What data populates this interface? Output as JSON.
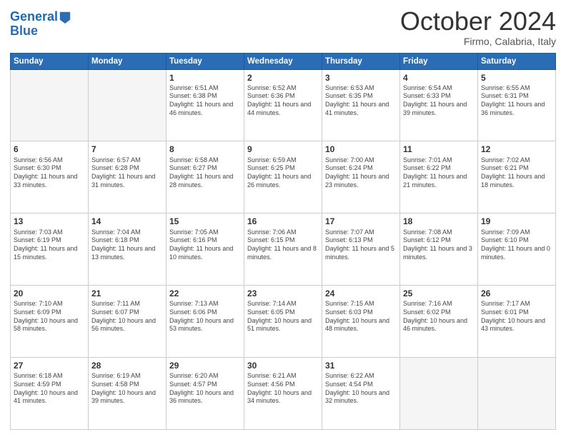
{
  "header": {
    "logo_line1": "General",
    "logo_line2": "Blue",
    "month_title": "October 2024",
    "subtitle": "Firmo, Calabria, Italy"
  },
  "days_of_week": [
    "Sunday",
    "Monday",
    "Tuesday",
    "Wednesday",
    "Thursday",
    "Friday",
    "Saturday"
  ],
  "weeks": [
    [
      {
        "day": "",
        "info": ""
      },
      {
        "day": "",
        "info": ""
      },
      {
        "day": "1",
        "info": "Sunrise: 6:51 AM\nSunset: 6:38 PM\nDaylight: 11 hours and 46 minutes."
      },
      {
        "day": "2",
        "info": "Sunrise: 6:52 AM\nSunset: 6:36 PM\nDaylight: 11 hours and 44 minutes."
      },
      {
        "day": "3",
        "info": "Sunrise: 6:53 AM\nSunset: 6:35 PM\nDaylight: 11 hours and 41 minutes."
      },
      {
        "day": "4",
        "info": "Sunrise: 6:54 AM\nSunset: 6:33 PM\nDaylight: 11 hours and 39 minutes."
      },
      {
        "day": "5",
        "info": "Sunrise: 6:55 AM\nSunset: 6:31 PM\nDaylight: 11 hours and 36 minutes."
      }
    ],
    [
      {
        "day": "6",
        "info": "Sunrise: 6:56 AM\nSunset: 6:30 PM\nDaylight: 11 hours and 33 minutes."
      },
      {
        "day": "7",
        "info": "Sunrise: 6:57 AM\nSunset: 6:28 PM\nDaylight: 11 hours and 31 minutes."
      },
      {
        "day": "8",
        "info": "Sunrise: 6:58 AM\nSunset: 6:27 PM\nDaylight: 11 hours and 28 minutes."
      },
      {
        "day": "9",
        "info": "Sunrise: 6:59 AM\nSunset: 6:25 PM\nDaylight: 11 hours and 26 minutes."
      },
      {
        "day": "10",
        "info": "Sunrise: 7:00 AM\nSunset: 6:24 PM\nDaylight: 11 hours and 23 minutes."
      },
      {
        "day": "11",
        "info": "Sunrise: 7:01 AM\nSunset: 6:22 PM\nDaylight: 11 hours and 21 minutes."
      },
      {
        "day": "12",
        "info": "Sunrise: 7:02 AM\nSunset: 6:21 PM\nDaylight: 11 hours and 18 minutes."
      }
    ],
    [
      {
        "day": "13",
        "info": "Sunrise: 7:03 AM\nSunset: 6:19 PM\nDaylight: 11 hours and 15 minutes."
      },
      {
        "day": "14",
        "info": "Sunrise: 7:04 AM\nSunset: 6:18 PM\nDaylight: 11 hours and 13 minutes."
      },
      {
        "day": "15",
        "info": "Sunrise: 7:05 AM\nSunset: 6:16 PM\nDaylight: 11 hours and 10 minutes."
      },
      {
        "day": "16",
        "info": "Sunrise: 7:06 AM\nSunset: 6:15 PM\nDaylight: 11 hours and 8 minutes."
      },
      {
        "day": "17",
        "info": "Sunrise: 7:07 AM\nSunset: 6:13 PM\nDaylight: 11 hours and 5 minutes."
      },
      {
        "day": "18",
        "info": "Sunrise: 7:08 AM\nSunset: 6:12 PM\nDaylight: 11 hours and 3 minutes."
      },
      {
        "day": "19",
        "info": "Sunrise: 7:09 AM\nSunset: 6:10 PM\nDaylight: 11 hours and 0 minutes."
      }
    ],
    [
      {
        "day": "20",
        "info": "Sunrise: 7:10 AM\nSunset: 6:09 PM\nDaylight: 10 hours and 58 minutes."
      },
      {
        "day": "21",
        "info": "Sunrise: 7:11 AM\nSunset: 6:07 PM\nDaylight: 10 hours and 56 minutes."
      },
      {
        "day": "22",
        "info": "Sunrise: 7:13 AM\nSunset: 6:06 PM\nDaylight: 10 hours and 53 minutes."
      },
      {
        "day": "23",
        "info": "Sunrise: 7:14 AM\nSunset: 6:05 PM\nDaylight: 10 hours and 51 minutes."
      },
      {
        "day": "24",
        "info": "Sunrise: 7:15 AM\nSunset: 6:03 PM\nDaylight: 10 hours and 48 minutes."
      },
      {
        "day": "25",
        "info": "Sunrise: 7:16 AM\nSunset: 6:02 PM\nDaylight: 10 hours and 46 minutes."
      },
      {
        "day": "26",
        "info": "Sunrise: 7:17 AM\nSunset: 6:01 PM\nDaylight: 10 hours and 43 minutes."
      }
    ],
    [
      {
        "day": "27",
        "info": "Sunrise: 6:18 AM\nSunset: 4:59 PM\nDaylight: 10 hours and 41 minutes."
      },
      {
        "day": "28",
        "info": "Sunrise: 6:19 AM\nSunset: 4:58 PM\nDaylight: 10 hours and 39 minutes."
      },
      {
        "day": "29",
        "info": "Sunrise: 6:20 AM\nSunset: 4:57 PM\nDaylight: 10 hours and 36 minutes."
      },
      {
        "day": "30",
        "info": "Sunrise: 6:21 AM\nSunset: 4:56 PM\nDaylight: 10 hours and 34 minutes."
      },
      {
        "day": "31",
        "info": "Sunrise: 6:22 AM\nSunset: 4:54 PM\nDaylight: 10 hours and 32 minutes."
      },
      {
        "day": "",
        "info": ""
      },
      {
        "day": "",
        "info": ""
      }
    ]
  ]
}
